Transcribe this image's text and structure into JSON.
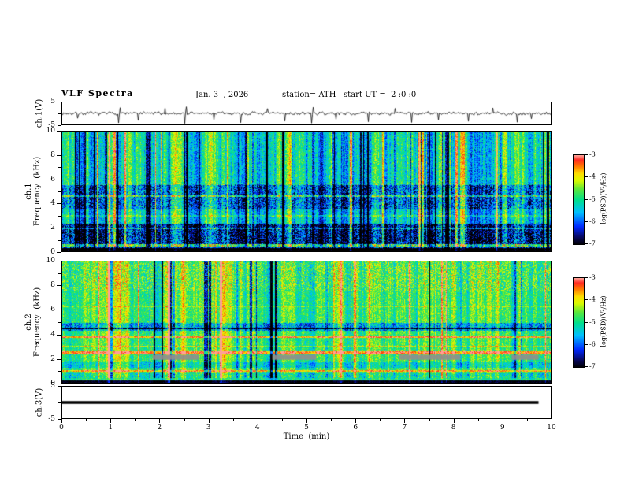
{
  "title": "VLF  Spectra",
  "header": {
    "date": "Jan. 3  , 2026",
    "station": "station= ATH",
    "start_ut": "start UT =  2 :0 :0"
  },
  "xaxis": {
    "label": "Time  (min)",
    "min": 0,
    "max": 10,
    "major_ticks": [
      0,
      1,
      2,
      3,
      4,
      5,
      6,
      7,
      8,
      9,
      10
    ],
    "minor_tick_step": 0.5
  },
  "panels": {
    "wave1": {
      "ylabel": "ch.1(V)",
      "ylim": [
        -5,
        5
      ],
      "ytick_labels": [
        5,
        -5
      ]
    },
    "spec1": {
      "ylabel": "ch.1\nFrequency  (kHz)",
      "ylim": [
        0,
        10
      ],
      "ytick_labels": [
        0,
        2,
        4,
        6,
        8,
        10
      ]
    },
    "spec2": {
      "ylabel": "ch.2\nFrequency  (kHz)",
      "ylim": [
        0,
        10
      ],
      "ytick_labels": [
        0,
        2,
        4,
        6,
        8,
        10
      ]
    },
    "wave3": {
      "ylabel": "ch.3(V)",
      "ylim": [
        -5,
        5
      ],
      "ytick_labels": [
        5,
        -5
      ]
    }
  },
  "colorbar": {
    "label": "log(PSD)(V²/Hz)",
    "ticks": [
      -3,
      -4,
      -5,
      -6,
      -7
    ],
    "zmin": -7,
    "zmax": -3
  },
  "colormap": {
    "zmin": -7,
    "zmax": -3,
    "stops": [
      {
        "t": 0.0,
        "c": "#000000"
      },
      {
        "t": 0.08,
        "c": "#08085a"
      },
      {
        "t": 0.2,
        "c": "#0028ff"
      },
      {
        "t": 0.36,
        "c": "#00c0ff"
      },
      {
        "t": 0.5,
        "c": "#00e08c"
      },
      {
        "t": 0.62,
        "c": "#5ae83c"
      },
      {
        "t": 0.72,
        "c": "#dcfa00"
      },
      {
        "t": 0.8,
        "c": "#ffdc00"
      },
      {
        "t": 0.88,
        "c": "#ff7800"
      },
      {
        "t": 0.95,
        "c": "#ff2820"
      },
      {
        "t": 1.0,
        "c": "#ffa096"
      }
    ]
  },
  "chart_data": [
    {
      "type": "line",
      "name": "ch.1 raw voltage",
      "ylabel": "ch.1(V)",
      "xlabel": "Time (min)",
      "xlim": [
        0,
        10
      ],
      "ylim": [
        -5,
        5
      ],
      "description": "Broadband noise around 0 V (~±1 V) with sparse impulsive vertical spikes",
      "line_color": "#000000",
      "noise_amp": 0.9,
      "spikes": [
        {
          "x": 0.3,
          "a": -2.2
        },
        {
          "x": 1.15,
          "a": -4.3
        },
        {
          "x": 1.18,
          "a": 2.6
        },
        {
          "x": 1.55,
          "a": -3.2
        },
        {
          "x": 2.1,
          "a": 2.4
        },
        {
          "x": 2.5,
          "a": -4.6
        },
        {
          "x": 2.53,
          "a": 3.0
        },
        {
          "x": 3.1,
          "a": -2.8
        },
        {
          "x": 3.65,
          "a": -4.2
        },
        {
          "x": 4.2,
          "a": 2.2
        },
        {
          "x": 4.55,
          "a": -3.5
        },
        {
          "x": 5.1,
          "a": -4.4
        },
        {
          "x": 5.13,
          "a": 2.8
        },
        {
          "x": 5.6,
          "a": -2.6
        },
        {
          "x": 6.25,
          "a": -3.8
        },
        {
          "x": 6.8,
          "a": 2.3
        },
        {
          "x": 7.15,
          "a": -4.1
        },
        {
          "x": 7.7,
          "a": -2.9
        },
        {
          "x": 8.3,
          "a": -3.6
        },
        {
          "x": 8.8,
          "a": 2.5
        },
        {
          "x": 9.3,
          "a": -4.0
        },
        {
          "x": 9.6,
          "a": -2.4
        }
      ]
    },
    {
      "type": "heatmap",
      "name": "ch.1 spectrogram",
      "ylabel": "ch.1 Frequency (kHz)",
      "xlabel": "Time (min)",
      "xlim": [
        0,
        10
      ],
      "ylim": [
        0,
        10
      ],
      "zlabel": "log(PSD)(V²/Hz)",
      "zlim": [
        -7,
        -3
      ],
      "description": "Mostly green (~-5) with dense vertical blue/dark streaks; dark-blue band 0.3-2.3 kHz, bluer patchy band 3.5-5.6 kHz, black floor below 0.3 kHz, thin bright horizontal lines near 0.55, 2, 3, 4.65 kHz",
      "render": {
        "seed": 101,
        "base": -4.9,
        "streak_strength": 1.0,
        "streak_density": 0.6,
        "bands": [
          {
            "f0": 0.0,
            "f1": 0.32,
            "dv": -2.2,
            "noise": 0.25
          },
          {
            "f0": 0.32,
            "f1": 2.35,
            "dv": -1.35,
            "noise": 0.95
          },
          {
            "f0": 2.35,
            "f1": 3.5,
            "dv": -0.2,
            "noise": 0.55
          },
          {
            "f0": 3.5,
            "f1": 5.6,
            "dv": -0.75,
            "noise": 0.85
          },
          {
            "f0": 5.6,
            "f1": 10.01,
            "dv": 0.0,
            "noise": 0.55
          }
        ],
        "lines": [
          {
            "f": 0.55,
            "dv": 1.7,
            "w": 0.09
          },
          {
            "f": 1.95,
            "dv": 0.9,
            "w": 0.07
          },
          {
            "f": 3.0,
            "dv": 0.5,
            "w": 0.06
          },
          {
            "f": 4.65,
            "dv": 1.15,
            "w": 0.08
          },
          {
            "f": 5.6,
            "dv": 0.6,
            "w": 0.06
          }
        ]
      }
    },
    {
      "type": "heatmap",
      "name": "ch.2 spectrogram",
      "ylabel": "ch.2 Frequency (kHz)",
      "xlabel": "Time (min)",
      "xlim": [
        0,
        10
      ],
      "ylim": [
        0,
        10
      ],
      "zlabel": "log(PSD)(V²/Hz)",
      "zlim": [
        -7,
        -3
      ],
      "description": "Mostly green/yellow-green with milder streaks; yellow-orange lines near 1, 2.5, 3.8 kHz, dark line ~4.5 kHz, cyan band 1.3-1.75 kHz, gray dashed bar segments ~2 kHz, red specks above 7.6 kHz, black floor below 0.25 kHz",
      "render": {
        "seed": 202,
        "base": -4.6,
        "streak_strength": 0.7,
        "streak_density": 0.4,
        "bands": [
          {
            "f0": 0.0,
            "f1": 0.25,
            "dv": -2.3,
            "noise": 0.2
          },
          {
            "f0": 0.25,
            "f1": 0.85,
            "dv": -0.35,
            "noise": 0.6
          },
          {
            "f0": 1.25,
            "f1": 1.75,
            "dv": -0.5,
            "noise": 0.5
          },
          {
            "f0": 4.35,
            "f1": 4.95,
            "dv": -0.85,
            "noise": 0.75
          },
          {
            "f0": 7.6,
            "f1": 10.01,
            "dv": 0.1,
            "noise": 0.75
          }
        ],
        "lines": [
          {
            "f": 1.0,
            "dv": 1.2,
            "w": 0.08
          },
          {
            "f": 2.5,
            "dv": 1.5,
            "w": 0.1
          },
          {
            "f": 3.05,
            "dv": 0.7,
            "w": 0.06
          },
          {
            "f": 3.8,
            "dv": 1.35,
            "w": 0.09
          },
          {
            "f": 4.5,
            "dv": -1.5,
            "w": 0.07
          },
          {
            "f": 6.3,
            "dv": 0.5,
            "w": 0.05
          }
        ],
        "gray_segments": {
          "f0": 1.9,
          "f1": 2.3,
          "color": "#8f8f8f",
          "x_ranges": [
            [
              1.85,
              2.8
            ],
            [
              4.3,
              5.2
            ],
            [
              6.9,
              8.15
            ],
            [
              9.2,
              9.75
            ]
          ]
        }
      }
    },
    {
      "type": "line",
      "name": "ch.3 raw voltage",
      "ylabel": "ch.3(V)",
      "xlabel": "Time (min)",
      "xlim": [
        0,
        10
      ],
      "ylim": [
        -5,
        5
      ],
      "value": 0,
      "x_end": 9.75,
      "description": "Constant 0 V thick flat black line ending near 9.75 min",
      "line_color": "#000000",
      "line_width": 3.5
    }
  ]
}
